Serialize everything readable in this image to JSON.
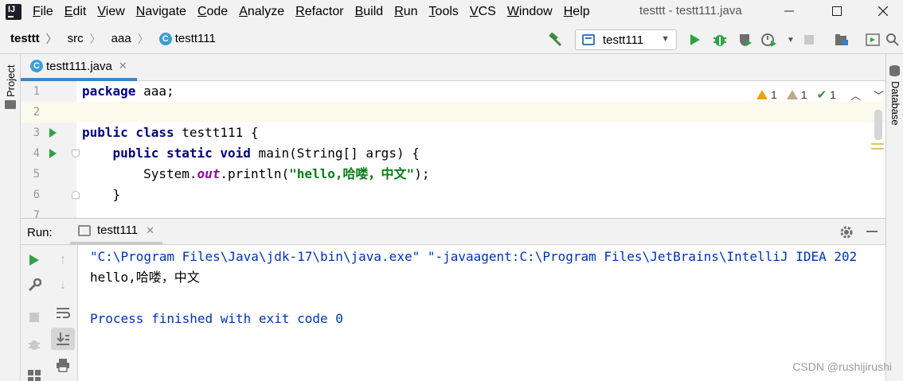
{
  "menu": {
    "items": [
      "File",
      "Edit",
      "View",
      "Navigate",
      "Code",
      "Analyze",
      "Refactor",
      "Build",
      "Run",
      "Tools",
      "VCS",
      "Window",
      "Help"
    ],
    "window_title": "testtt - testt111.java",
    "logo_text": "IJ"
  },
  "breadcrumbs": {
    "project": "testtt",
    "src": "src",
    "package": "aaa",
    "class": "testt111"
  },
  "run_config": {
    "label": "testt111"
  },
  "side_tabs": {
    "project": "Project",
    "database": "Database"
  },
  "editor": {
    "tab_label": "testt111.java",
    "lines": [
      {
        "num": "1",
        "tokens": [
          {
            "t": "package",
            "c": "kw"
          },
          {
            "t": " aaa;",
            "c": ""
          }
        ]
      },
      {
        "num": "2",
        "tokens": []
      },
      {
        "num": "3",
        "tokens": [
          {
            "t": "public class",
            "c": "kw"
          },
          {
            "t": " testt111 {",
            "c": ""
          }
        ]
      },
      {
        "num": "4",
        "tokens": [
          {
            "t": "    ",
            "c": ""
          },
          {
            "t": "public static void",
            "c": "kw"
          },
          {
            "t": " main(String[] args) {",
            "c": ""
          }
        ]
      },
      {
        "num": "5",
        "tokens": [
          {
            "t": "        System.",
            "c": ""
          },
          {
            "t": "out",
            "c": "italic-field"
          },
          {
            "t": ".println(",
            "c": ""
          },
          {
            "t": "\"hello,哈喽，中文\"",
            "c": "str"
          },
          {
            "t": ");",
            "c": ""
          }
        ]
      },
      {
        "num": "6",
        "tokens": [
          {
            "t": "    }",
            "c": ""
          }
        ]
      },
      {
        "num": "7",
        "tokens": []
      }
    ],
    "inspections": {
      "warnings": "1",
      "weak_warnings": "1",
      "ok": "1"
    }
  },
  "run_panel": {
    "label": "Run:",
    "tab_label": "testt111",
    "console": [
      {
        "text": "\"C:\\Program Files\\Java\\jdk-17\\bin\\java.exe\" \"-javaagent:C:\\Program Files\\JetBrains\\IntelliJ IDEA 202",
        "kind": "sys"
      },
      {
        "text": "hello,哈喽，中文",
        "kind": "out"
      },
      {
        "text": "",
        "kind": "out"
      },
      {
        "text": "Process finished with exit code 0",
        "kind": "sys"
      }
    ]
  },
  "watermark": "CSDN @rushijirushi",
  "colors": {
    "keyword": "#000080",
    "string": "#067d17",
    "run_green": "#2fa344",
    "tab_accent": "#4083c9"
  }
}
